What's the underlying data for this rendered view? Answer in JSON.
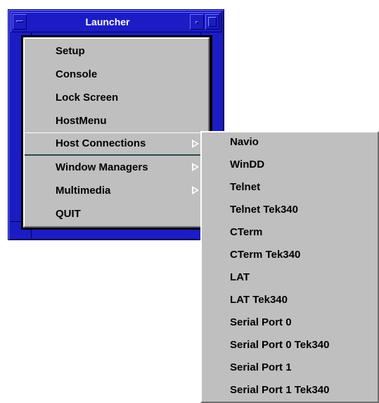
{
  "window": {
    "title": "Launcher"
  },
  "main_menu": {
    "items": [
      {
        "label": "Setup",
        "submenu": false
      },
      {
        "label": "Console",
        "submenu": false
      },
      {
        "label": "Lock Screen",
        "submenu": false
      },
      {
        "label": "HostMenu",
        "submenu": false
      },
      {
        "label": "Host Connections",
        "submenu": true,
        "active": true
      },
      {
        "label": "Window Managers",
        "submenu": true
      },
      {
        "label": "Multimedia",
        "submenu": true
      },
      {
        "label": "QUIT",
        "submenu": false
      }
    ]
  },
  "submenu": {
    "items": [
      {
        "label": "Navio"
      },
      {
        "label": "WinDD"
      },
      {
        "label": "Telnet"
      },
      {
        "label": "Telnet Tek340"
      },
      {
        "label": "CTerm"
      },
      {
        "label": "CTerm Tek340"
      },
      {
        "label": "LAT"
      },
      {
        "label": "LAT Tek340"
      },
      {
        "label": "Serial Port 0"
      },
      {
        "label": "Serial Port 0 Tek340"
      },
      {
        "label": "Serial Port 1"
      },
      {
        "label": "Serial Port 1 Tek340"
      }
    ]
  },
  "colors": {
    "frame": "#1c1cc4",
    "menu_background": "#bfbfbf",
    "client_background": "#000000"
  }
}
